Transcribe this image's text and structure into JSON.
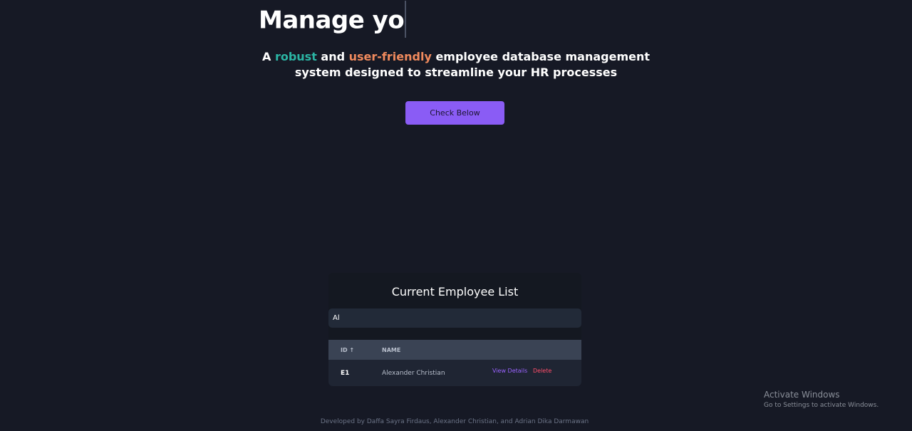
{
  "hero": {
    "title": "Manage yo",
    "subtitle_parts": [
      "A ",
      "robust",
      " and ",
      "user-friendly",
      " employee database management system designed to streamline your HR processes"
    ],
    "cta_label": "Check Below"
  },
  "employee_list": {
    "title": "Current Employee List",
    "search_value": "Al",
    "columns": {
      "id": "ID ↑",
      "name": "NAME"
    },
    "rows": [
      {
        "id": "E1",
        "name": "Alexander Christian",
        "view_label": "View Details",
        "delete_label": "Delete"
      }
    ]
  },
  "footer": {
    "text": "Developed by Daffa Sayra Firdaus, Alexander Christian, and Adrian Dika Darmawan"
  },
  "windows_watermark": {
    "title": "Activate Windows",
    "subtitle": "Go to Settings to activate Windows."
  },
  "colors": {
    "background": "#161925",
    "accent_teal": "#2bb5a4",
    "accent_orange": "#f08a5d",
    "accent_pink": "#e36a98",
    "button": "#8a5cf5",
    "view_link": "#9b63ff",
    "delete_link": "#ff4d6a"
  }
}
